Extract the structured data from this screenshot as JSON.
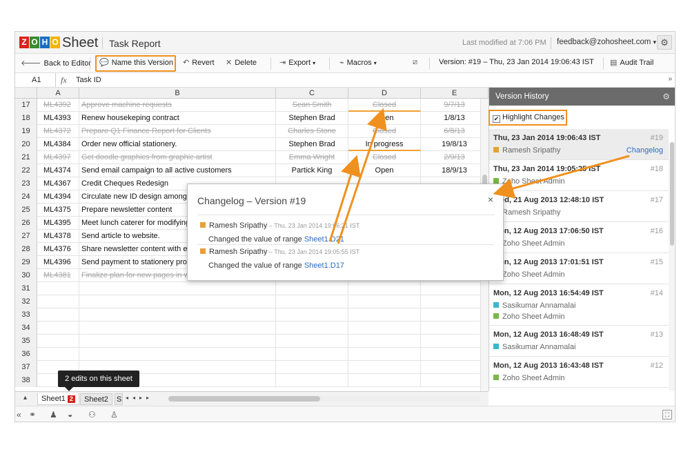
{
  "app": {
    "logo_letters": [
      "Z",
      "O",
      "H",
      "O"
    ],
    "logo_colors": [
      "#d9231d",
      "#3a8a2f",
      "#1c6cc0",
      "#f4b400"
    ],
    "name": "Sheet",
    "doc_title": "Task Report",
    "last_modified": "Last modified at 7:06 PM",
    "account": "feedback@zohosheet.com",
    "account_caret": "▾"
  },
  "toolbar": {
    "back_label": "Back to Editor",
    "name_version_label": "Name this Version",
    "revert_label": "Revert",
    "delete_label": "Delete",
    "export_label": "Export",
    "macros_label": "Macros",
    "version_info": "Version: #19 – Thu, 23 Jan 2014 19:06:43 IST",
    "audit_label": "Audit Trail"
  },
  "formula_bar": {
    "cell_ref": "A1",
    "fx": "fx",
    "value": "Task ID"
  },
  "grid": {
    "columns": [
      "A",
      "B",
      "C",
      "D",
      "E"
    ],
    "rows": [
      {
        "n": "17",
        "a": "ML4392",
        "b": "Approve machine requests",
        "c": "Sean Smith",
        "d": "Closed",
        "e": "9/7/13",
        "struck": true
      },
      {
        "n": "18",
        "a": "ML4393",
        "b": "Renew housekeping contract",
        "c": "Stephen Brad",
        "d": "Open",
        "e": "1/8/13",
        "struck": false
      },
      {
        "n": "19",
        "a": "ML4372",
        "b": "Prepare Q1 Finance Report for Clients",
        "c": "Charles Stone",
        "d": "Closed",
        "e": "6/8/13",
        "struck": true
      },
      {
        "n": "20",
        "a": "ML4384",
        "b": "Order new official stationery.",
        "c": "Stephen Brad",
        "d": "In progress",
        "e": "19/8/13",
        "struck": false
      },
      {
        "n": "21",
        "a": "ML4397",
        "b": "Get doodle graphics from graphic artist",
        "c": "Emma Wright",
        "d": "Closed",
        "e": "2/9/13",
        "struck": true
      },
      {
        "n": "22",
        "a": "ML4374",
        "b": "Send email campaign to all active customers",
        "c": "Partick King",
        "d": "Open",
        "e": "18/9/13",
        "struck": false
      },
      {
        "n": "23",
        "a": "ML4367",
        "b": "Credit Cheques Redesign",
        "c": "",
        "d": "",
        "e": "",
        "struck": false
      },
      {
        "n": "24",
        "a": "ML4394",
        "b": "Circulate new ID design among the team",
        "c": "",
        "d": "",
        "e": "",
        "struck": false
      },
      {
        "n": "25",
        "a": "ML4375",
        "b": "Prepare newsletter content",
        "c": "",
        "d": "",
        "e": "",
        "struck": false
      },
      {
        "n": "26",
        "a": "ML4395",
        "b": "Meet lunch caterer for modifying menu",
        "c": "",
        "d": "",
        "e": "",
        "struck": false
      },
      {
        "n": "27",
        "a": "ML4378",
        "b": "Send article to website.",
        "c": "",
        "d": "",
        "e": "",
        "struck": false
      },
      {
        "n": "28",
        "a": "ML4376",
        "b": "Share newsletter content with editors",
        "c": "",
        "d": "",
        "e": "",
        "struck": false
      },
      {
        "n": "29",
        "a": "ML4396",
        "b": "Send payment to stationery provider",
        "c": "",
        "d": "",
        "e": "",
        "struck": false
      },
      {
        "n": "30",
        "a": "ML4381",
        "b": "Finalize plan for new pages in website",
        "c": "",
        "d": "",
        "e": "",
        "struck": true
      },
      {
        "n": "31",
        "a": "",
        "b": "",
        "c": "",
        "d": "",
        "e": "",
        "struck": false
      },
      {
        "n": "32",
        "a": "",
        "b": "",
        "c": "",
        "d": "",
        "e": "",
        "struck": false
      },
      {
        "n": "33",
        "a": "",
        "b": "",
        "c": "",
        "d": "",
        "e": "",
        "struck": false
      },
      {
        "n": "34",
        "a": "",
        "b": "",
        "c": "",
        "d": "",
        "e": "",
        "struck": false
      },
      {
        "n": "35",
        "a": "",
        "b": "",
        "c": "",
        "d": "",
        "e": "",
        "struck": false
      },
      {
        "n": "36",
        "a": "",
        "b": "",
        "c": "",
        "d": "",
        "e": "",
        "struck": false
      },
      {
        "n": "37",
        "a": "",
        "b": "",
        "c": "",
        "d": "",
        "e": "",
        "struck": false
      },
      {
        "n": "38",
        "a": "",
        "b": "",
        "c": "",
        "d": "",
        "e": "",
        "struck": false
      }
    ]
  },
  "sheets": {
    "tab1": "Sheet1",
    "tab1_badge": "2",
    "tab2": "Sheet2",
    "tab3": "S",
    "tooltip": "2 edits on this sheet"
  },
  "version_history": {
    "title": "Version History",
    "highlight_label": "Highlight Changes",
    "highlight_checked": true,
    "changelog_link": "Changelog",
    "items": [
      {
        "date": "Thu, 23 Jan 2014 19:06:43 IST",
        "num": "#19",
        "users": [
          {
            "name": "Ramesh Sripathy",
            "color": "#e8a03a"
          }
        ]
      },
      {
        "date": "Thu, 23 Jan 2014 19:05:25 IST",
        "num": "#18",
        "users": [
          {
            "name": "Zoho Sheet Admin",
            "color": "#7ab648"
          }
        ]
      },
      {
        "date": "Wed, 21 Aug 2013 12:48:10 IST",
        "num": "#17",
        "users": [
          {
            "name": "Ramesh Sripathy",
            "color": "#e8a03a"
          }
        ]
      },
      {
        "date": "Mon, 12 Aug 2013 17:06:50 IST",
        "num": "#16",
        "users": [
          {
            "name": "Zoho Sheet Admin",
            "color": "#7ab648"
          }
        ]
      },
      {
        "date": "Mon, 12 Aug 2013 17:01:51 IST",
        "num": "#15",
        "users": [
          {
            "name": "Zoho Sheet Admin",
            "color": "#7ab648"
          }
        ]
      },
      {
        "date": "Mon, 12 Aug 2013 16:54:49 IST",
        "num": "#14",
        "users": [
          {
            "name": "Sasikumar Annamalai",
            "color": "#3db6cf"
          },
          {
            "name": "Zoho Sheet Admin",
            "color": "#7ab648"
          }
        ]
      },
      {
        "date": "Mon, 12 Aug 2013 16:48:49 IST",
        "num": "#13",
        "users": [
          {
            "name": "Sasikumar Annamalai",
            "color": "#3db6cf"
          }
        ]
      },
      {
        "date": "Mon, 12 Aug 2013 16:43:48 IST",
        "num": "#12",
        "users": [
          {
            "name": "Zoho Sheet Admin",
            "color": "#7ab648"
          }
        ]
      }
    ]
  },
  "changelog": {
    "title": "Changelog – Version #19",
    "close": "×",
    "entries": [
      {
        "user": "Ramesh Sripathy",
        "time": " – Thu, 23 Jan 2014 19:06:21 IST",
        "desc": "Changed the value of range ",
        "range": "Sheet1.D21",
        "color": "#e8a03a"
      },
      {
        "user": "Ramesh Sripathy",
        "time": " – Thu, 23 Jan 2014 19:05:55 IST",
        "desc": "Changed the value of range ",
        "range": "Sheet1.D17",
        "color": "#e8a03a"
      }
    ]
  },
  "colors": {
    "accent": "#f0901e",
    "link": "#2a6cc0"
  }
}
